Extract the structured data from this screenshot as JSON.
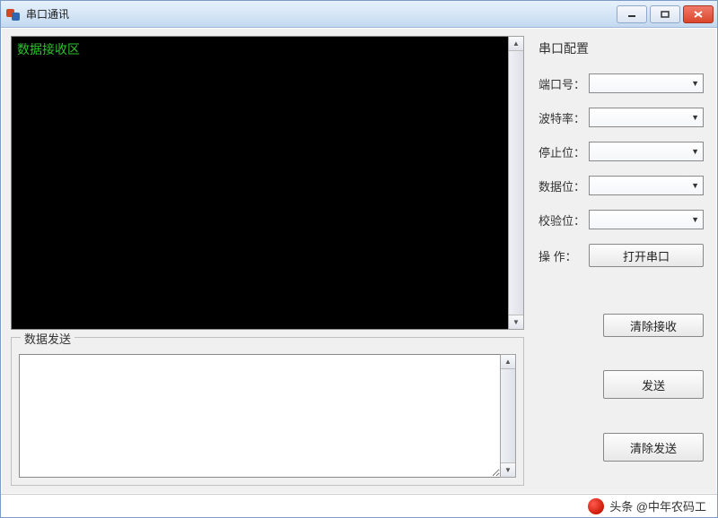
{
  "window": {
    "title": "串口通讯"
  },
  "receive": {
    "placeholder_text": "数据接收区"
  },
  "config": {
    "header": "串口配置",
    "port": {
      "label": "端口号：",
      "value": ""
    },
    "baud": {
      "label": "波特率：",
      "value": ""
    },
    "stopbits": {
      "label": "停止位：",
      "value": ""
    },
    "databits": {
      "label": "数据位：",
      "value": ""
    },
    "parity": {
      "label": "校验位：",
      "value": ""
    },
    "operation": {
      "label": "操  作：",
      "button": "打开串口"
    },
    "clear_recv": "清除接收"
  },
  "send": {
    "group_title": "数据发送",
    "send_button": "发送",
    "clear_send_button": "清除发送"
  },
  "footer": {
    "attribution": "头条 @中年农码工"
  }
}
